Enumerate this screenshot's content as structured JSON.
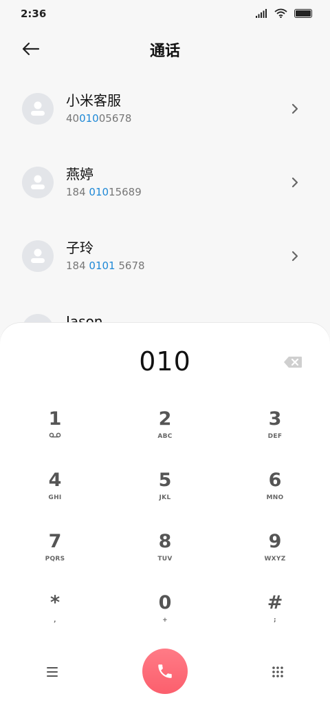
{
  "status_bar": {
    "time": "2:36"
  },
  "header": {
    "title": "通话"
  },
  "contacts": [
    {
      "name": "小米客服",
      "number_parts": [
        "40",
        "010",
        "05678"
      ]
    },
    {
      "name": "燕婷",
      "number_parts": [
        "184 ",
        "010",
        "15689"
      ]
    },
    {
      "name": "子玲",
      "number_parts": [
        "184 ",
        "0101",
        " 5678"
      ]
    },
    {
      "name": "Jason",
      "number_parts": [
        "",
        "",
        ""
      ]
    }
  ],
  "dialpad": {
    "display": "010",
    "keys": [
      {
        "digit": "1",
        "letters": ""
      },
      {
        "digit": "2",
        "letters": "ABC"
      },
      {
        "digit": "3",
        "letters": "DEF"
      },
      {
        "digit": "4",
        "letters": "GHI"
      },
      {
        "digit": "5",
        "letters": "JKL"
      },
      {
        "digit": "6",
        "letters": "MNO"
      },
      {
        "digit": "7",
        "letters": "PQRS"
      },
      {
        "digit": "8",
        "letters": "TUV"
      },
      {
        "digit": "9",
        "letters": "WXYZ"
      },
      {
        "digit": "*",
        "letters": ","
      },
      {
        "digit": "0",
        "letters": "+"
      },
      {
        "digit": "#",
        "letters": ";"
      }
    ]
  },
  "colors": {
    "highlight": "#1e88d6",
    "call_button": "#fb6a77",
    "avatar_bg": "#e3e5e9"
  },
  "icons": {
    "signal": "signal-icon",
    "wifi": "wifi-icon",
    "battery": "battery-icon",
    "back": "back-arrow-icon",
    "chevron": "chevron-right-icon",
    "backspace": "backspace-icon",
    "voicemail": "voicemail-icon",
    "menu": "menu-icon",
    "call": "phone-icon",
    "dialpad": "dialpad-icon"
  }
}
